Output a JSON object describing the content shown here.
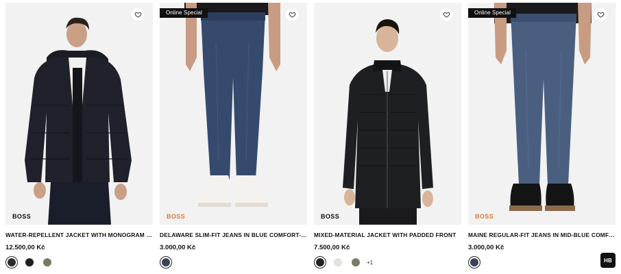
{
  "products": [
    {
      "badge": "",
      "brand": "BOSS",
      "brand_color": "#111111",
      "title": "WATER-REPELLENT JACKET WITH MONOGRAM JACQU...",
      "price": "12.500,00 Kč",
      "swatches": [
        "#2b2b2b",
        "#1f1f1f",
        "#7a7a62"
      ],
      "selected_swatch": 0,
      "more": "",
      "image": "black-puffer-jacket-model"
    },
    {
      "badge": "Online Special",
      "brand": "BOSS",
      "brand_color": "#d9793a",
      "title": "DELAWARE SLIM-FIT JEANS IN BLUE COMFORT-STRETC...",
      "price": "3.000,00 Kč",
      "swatches": [
        "#3b4358"
      ],
      "selected_swatch": 0,
      "more": "",
      "image": "blue-jeans-white-sneakers"
    },
    {
      "badge": "",
      "brand": "BOSS",
      "brand_color": "#111111",
      "title": "MIXED-MATERIAL JACKET WITH PADDED FRONT",
      "price": "7.500,00 Kč",
      "swatches": [
        "#222222",
        "#e3e1dc",
        "#7b7a64"
      ],
      "selected_swatch": 0,
      "more": "+1",
      "image": "padded-black-jacket-model"
    },
    {
      "badge": "Online Special",
      "brand": "BOSS",
      "brand_color": "#d9793a",
      "title": "MAINE REGULAR-FIT JEANS IN MID-BLUE COMFORT-ST...",
      "price": "3.000,00 Kč",
      "swatches": [
        "#3a4257"
      ],
      "selected_swatch": 0,
      "more": "",
      "image": "mid-blue-jeans-brown-boots"
    }
  ],
  "hb_badge": "HB",
  "icons": {
    "wishlist": "heart-outline-icon"
  }
}
